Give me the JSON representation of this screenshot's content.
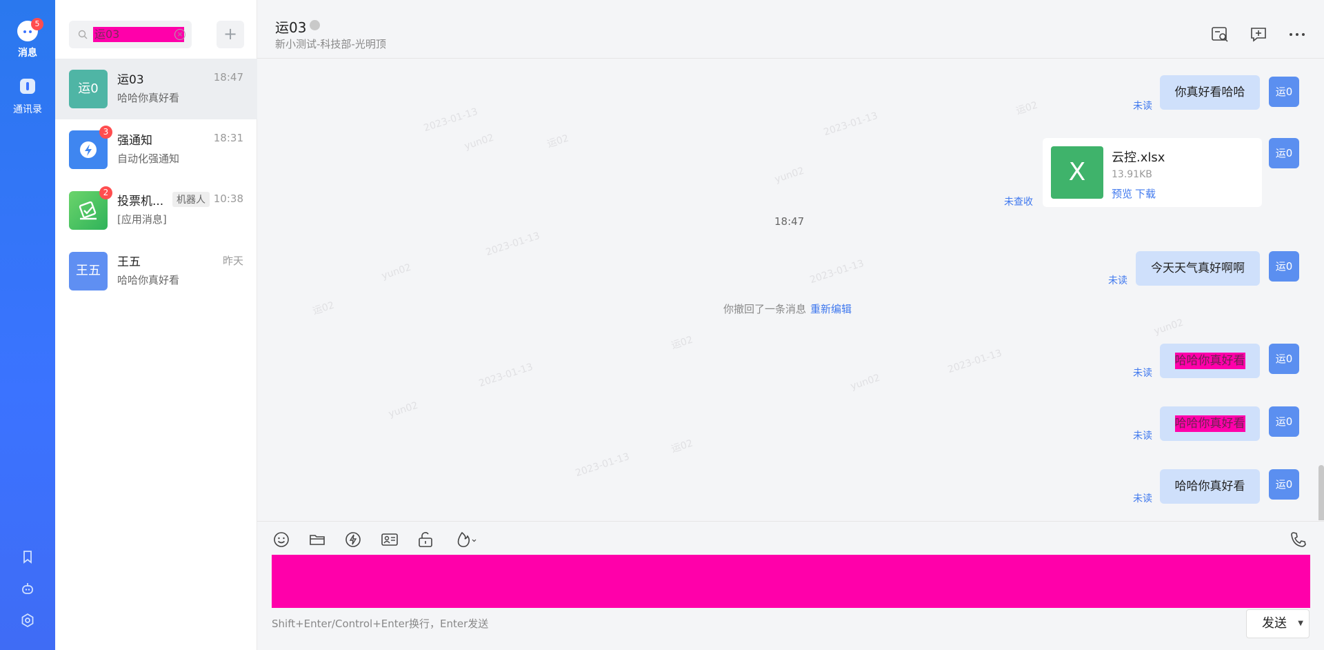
{
  "rail": {
    "messages_label": "消息",
    "messages_badge": "5",
    "contacts_label": "通讯录"
  },
  "search": {
    "value": "运03"
  },
  "add_label": "+",
  "conversations": [
    {
      "avatar": "运0",
      "name": "运03",
      "time": "18:47",
      "preview": "哈哈你真好看",
      "badge": "",
      "tag": "",
      "color": "#4fb5a5"
    },
    {
      "avatar": "",
      "name": "强通知",
      "time": "18:31",
      "preview": "自动化强通知",
      "badge": "3",
      "tag": "",
      "color": "#3f86f0"
    },
    {
      "avatar": "",
      "name": "投票机...",
      "time": "10:38",
      "preview": "[应用消息]",
      "badge": "2",
      "tag": "机器人",
      "color": "#4cc35a"
    },
    {
      "avatar": "王五",
      "name": "王五",
      "time": "昨天",
      "preview": "哈哈你真好看",
      "badge": "",
      "tag": "",
      "color": "#5f8ff2"
    }
  ],
  "chat": {
    "title": "运03",
    "subtitle": "新小测试-科技部-光明顶",
    "watermarks": [
      "yun02",
      "运02",
      "2023-01-13"
    ],
    "sys_time": "18:47",
    "recall_text": "你撤回了一条消息",
    "recall_action": "重新编辑",
    "my_avatar": "运0",
    "messages": [
      {
        "text": "你真好看哈哈",
        "status": "未读",
        "highlight": false
      },
      {
        "text": "今天天气真好啊啊",
        "status": "未读",
        "highlight": false
      },
      {
        "text": "哈哈你真好看",
        "status": "未读",
        "highlight": true
      },
      {
        "text": "哈哈你真好看",
        "status": "未读",
        "highlight": true
      },
      {
        "text": "哈哈你真好看",
        "status": "未读",
        "highlight": false
      }
    ],
    "file": {
      "icon_letter": "X",
      "name": "云控.xlsx",
      "size": "13.91KB",
      "preview": "预览",
      "download": "下载",
      "status": "未查收"
    }
  },
  "composer": {
    "hint": "Shift+Enter/Control+Enter换行，Enter发送",
    "send_label": "发送"
  },
  "colors": {
    "rail": "#3b73ff",
    "accent": "#3f78ee",
    "bubble": "#cfe0fb",
    "redaction": "#ff00aa"
  }
}
